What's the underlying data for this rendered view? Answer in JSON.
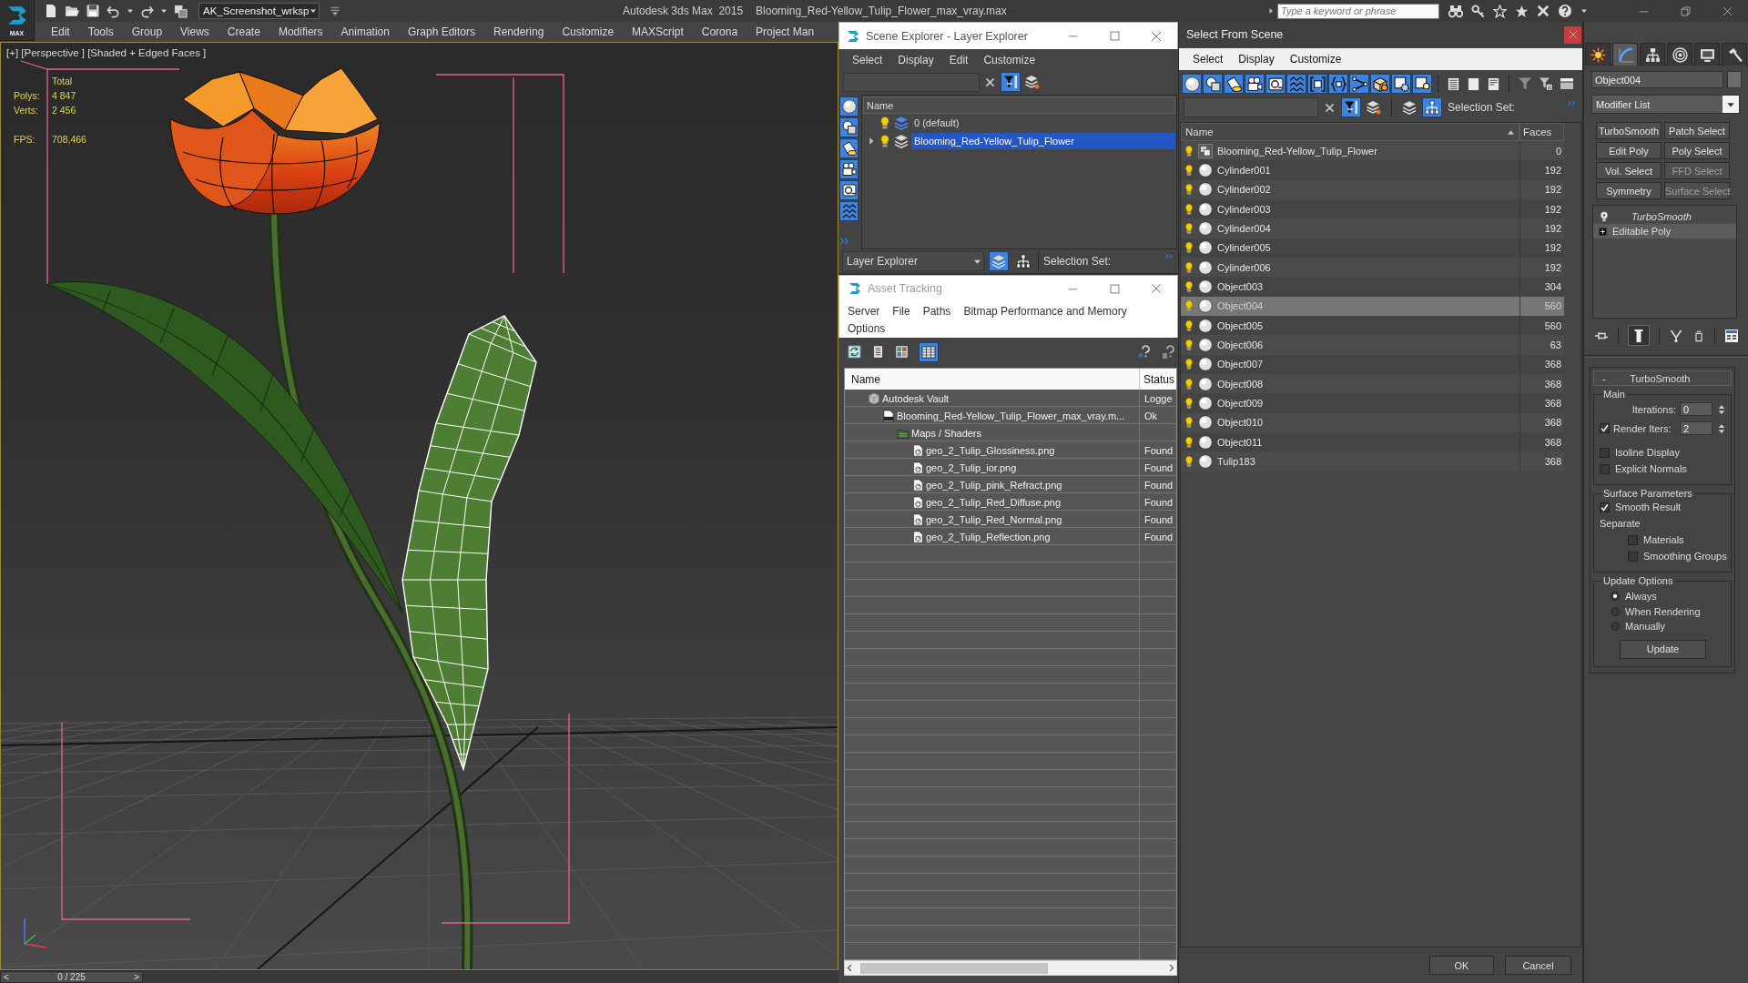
{
  "title_bar": {
    "logo_text": "MAX",
    "workspace": "AK_Screenshot_wrksp",
    "app_name": "Autodesk 3ds Max  2015",
    "file_name": "Blooming_Red-Yellow_Tulip_Flower_max_vray.max",
    "search": {
      "placeholder": "Type a keyword or phrase"
    }
  },
  "menu": [
    "Edit",
    "Tools",
    "Group",
    "Views",
    "Create",
    "Modifiers",
    "Animation",
    "Graph Editors",
    "Rendering",
    "Customize",
    "MAXScript",
    "Corona",
    "Project Man"
  ],
  "viewport": {
    "label": "[+] [Perspective ] [Shaded + Edged Faces ]",
    "stats_heading": "Total",
    "stats": [
      {
        "label": "Polys:",
        "value": "4 847"
      },
      {
        "label": "Verts:",
        "value": "2 456"
      },
      {
        "label": "FPS:",
        "value": "708,466"
      }
    ]
  },
  "time_slider": {
    "prev": "<",
    "position": "0 / 225",
    "next": ">",
    "level": 0
  },
  "scene_explorer": {
    "title": "Scene Explorer - Layer Explorer",
    "menu": [
      "Select",
      "Display",
      "Edit",
      "Customize"
    ],
    "filter_on": true,
    "type_filters": [
      {
        "on": true
      },
      {
        "on": true
      },
      {
        "on": true
      },
      {
        "on": true
      },
      {
        "on": true
      },
      {
        "on": true
      }
    ],
    "column": "Name",
    "layers": [
      {
        "name": "0 (default)",
        "visible": true,
        "current": true,
        "selected": false
      },
      {
        "name": "Blooming_Red-Yellow_Tulip_Flower",
        "expanded": false,
        "visible": true,
        "current": false,
        "selected": true
      }
    ],
    "explorer": "Layer Explorer",
    "layer_view_on": true,
    "hierarchy_on": false,
    "selection_set": "Selection Set:"
  },
  "asset_tracking": {
    "title": "Asset Tracking",
    "menu": [
      "Server",
      "File",
      "Paths",
      "Bitmap Performance and Memory",
      "Options"
    ],
    "views": [
      {
        "selected": false
      },
      {
        "selected": false
      },
      {
        "selected": true
      }
    ],
    "columns": [
      "Name",
      "Status"
    ],
    "assets": [
      {
        "kind": "vault",
        "name": "Autodesk Vault",
        "status": "Logge",
        "children": [
          {
            "kind": "scene-file",
            "name": "Blooming_Red-Yellow_Tulip_Flower_max_vray.m...",
            "status": "Ok",
            "children": [
              {
                "kind": "folder",
                "name": "Maps / Shaders",
                "children": [
                  {
                    "kind": "image",
                    "name": "geo_2_Tulip_Glossiness.png",
                    "status": "Found"
                  },
                  {
                    "kind": "image",
                    "name": "geo_2_Tulip_ior.png",
                    "status": "Found"
                  },
                  {
                    "kind": "image",
                    "name": "geo_2_Tulip_pink_Refract.png",
                    "status": "Found"
                  },
                  {
                    "kind": "image",
                    "name": "geo_2_Tulip_Red_Diffuse.png",
                    "status": "Found"
                  },
                  {
                    "kind": "image",
                    "name": "geo_2_Tulip_Red_Normal.png",
                    "status": "Found"
                  },
                  {
                    "kind": "image",
                    "name": "geo_2_Tulip_Reflection.png",
                    "status": "Found"
                  }
                ]
              }
            ]
          }
        ]
      }
    ]
  },
  "select_from_scene": {
    "title": "Select From Scene",
    "menu": [
      "Select",
      "Display",
      "Customize"
    ],
    "type_filters": [
      {
        "on": true
      },
      {
        "on": true
      },
      {
        "on": true
      },
      {
        "on": true
      },
      {
        "on": true
      },
      {
        "on": true
      },
      {
        "on": true
      },
      {
        "on": true
      },
      {
        "on": true
      },
      {
        "on": true
      },
      {
        "on": true
      },
      {
        "on": true
      }
    ],
    "filter_on": true,
    "hierarchy_on": true,
    "selection_set": "Selection Set:",
    "columns": [
      "Name",
      "Faces"
    ],
    "objects": [
      {
        "kind": "group",
        "name": "Blooming_Red-Yellow_Tulip_Flower",
        "faces": "0",
        "visible": true,
        "selected": false
      },
      {
        "kind": "geometry",
        "name": "Cylinder001",
        "faces": "192",
        "visible": true,
        "selected": false
      },
      {
        "kind": "geometry",
        "name": "Cylinder002",
        "faces": "192",
        "visible": true,
        "selected": false
      },
      {
        "kind": "geometry",
        "name": "Cylinder003",
        "faces": "192",
        "visible": true,
        "selected": false
      },
      {
        "kind": "geometry",
        "name": "Cylinder004",
        "faces": "192",
        "visible": true,
        "selected": false
      },
      {
        "kind": "geometry",
        "name": "Cylinder005",
        "faces": "192",
        "visible": true,
        "selected": false
      },
      {
        "kind": "geometry",
        "name": "Cylinder006",
        "faces": "192",
        "visible": true,
        "selected": false
      },
      {
        "kind": "geometry",
        "name": "Object003",
        "faces": "304",
        "visible": true,
        "selected": false
      },
      {
        "kind": "geometry",
        "name": "Object004",
        "faces": "560",
        "visible": true,
        "selected": true
      },
      {
        "kind": "geometry",
        "name": "Object005",
        "faces": "560",
        "visible": true,
        "selected": false
      },
      {
        "kind": "geometry",
        "name": "Object006",
        "faces": "63",
        "visible": true,
        "selected": false
      },
      {
        "kind": "geometry",
        "name": "Object007",
        "faces": "368",
        "visible": true,
        "selected": false
      },
      {
        "kind": "geometry",
        "name": "Object008",
        "faces": "368",
        "visible": true,
        "selected": false
      },
      {
        "kind": "geometry",
        "name": "Object009",
        "faces": "368",
        "visible": true,
        "selected": false
      },
      {
        "kind": "geometry",
        "name": "Object010",
        "faces": "368",
        "visible": true,
        "selected": false
      },
      {
        "kind": "geometry",
        "name": "Object011",
        "faces": "368",
        "visible": true,
        "selected": false
      },
      {
        "kind": "geometry",
        "name": "Tulip183",
        "faces": "368",
        "visible": true,
        "selected": false
      }
    ],
    "buttons": [
      "OK",
      "Cancel"
    ]
  },
  "command_panel": {
    "tabs": [
      {
        "selected": false
      },
      {
        "selected": true
      },
      {
        "selected": false
      },
      {
        "selected": false
      },
      {
        "selected": false
      },
      {
        "selected": false
      }
    ],
    "object_name": "Object004",
    "modifier_list": "Modifier List",
    "modifier_buttons": [
      {
        "label": "TurboSmooth",
        "disabled": false
      },
      {
        "label": "Patch Select",
        "disabled": false
      },
      {
        "label": "Edit Poly",
        "disabled": false
      },
      {
        "label": "Poly Select",
        "disabled": false
      },
      {
        "label": "Vol. Select",
        "disabled": false
      },
      {
        "label": "FFD Select",
        "disabled": true
      },
      {
        "label": "Symmetry",
        "disabled": false
      },
      {
        "label": "Surface Select",
        "disabled": true
      }
    ],
    "stack": [
      {
        "kind": "modifier",
        "name": "TurboSmooth",
        "viewport_on": false,
        "selected": false
      },
      {
        "kind": "base-object",
        "name": "Editable Poly",
        "expanded": false,
        "selected": true
      }
    ],
    "show_end_result": true,
    "rollout": {
      "title": "TurboSmooth",
      "toggle": "-",
      "groups": [
        {
          "title": "Main",
          "controls": [
            {
              "kind": "spinner",
              "label": "Iterations:",
              "value": "0"
            },
            {
              "kind": "check-spinner",
              "label": "Render Iters:",
              "value": "2",
              "checked": true
            },
            {
              "kind": "checkbox",
              "label": "Isoline Display",
              "checked": false
            },
            {
              "kind": "checkbox",
              "label": "Explicit Normals",
              "checked": false
            }
          ]
        },
        {
          "title": "Surface Parameters",
          "controls": [
            {
              "kind": "checkbox",
              "label": "Smooth Result",
              "checked": true
            },
            {
              "kind": "label",
              "label": "Separate",
              "children": [
                {
                  "kind": "checkbox",
                  "label": "Materials",
                  "checked": false
                },
                {
                  "kind": "checkbox",
                  "label": "Smoothing Groups",
                  "checked": false
                }
              ]
            }
          ]
        },
        {
          "title": "Update Options",
          "controls": [
            {
              "kind": "radio",
              "label": "Always",
              "selected": true
            },
            {
              "kind": "radio",
              "label": "When Rendering",
              "selected": false
            },
            {
              "kind": "radio",
              "label": "Manually",
              "selected": false
            },
            {
              "kind": "button",
              "label": "Update"
            }
          ]
        }
      ]
    }
  }
}
